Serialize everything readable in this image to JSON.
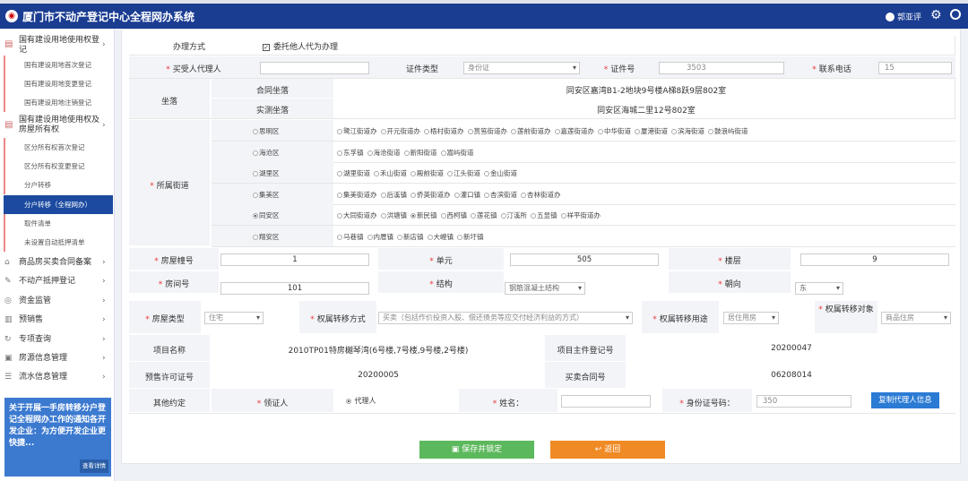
{
  "header": {
    "title": "厦门市不动产登记中心全程网办系统",
    "user": "郭亚评"
  },
  "sidebar": {
    "group1": "国有建设用地使用权登记",
    "group1_items": [
      "国有建设用地首次登记",
      "国有建设用地变更登记",
      "国有建设用地注销登记"
    ],
    "group2": "国有建设用地使用权及房屋所有权",
    "group2_items": [
      "区分所有权首次登记",
      "区分所有权变更登记",
      "分户转移",
      "分户转移（全程网办）",
      "取件清单",
      "未设置自动抵押清单"
    ],
    "menu": [
      "商品房买卖合同备案",
      "不动产抵押登记",
      "资金监管",
      "预销售",
      "专项查询",
      "房源信息管理",
      "流水信息管理"
    ],
    "notice": "关于开展一手房转移分户登记全程网办工作的通知各开发企业：为方便开发企业更快捷...",
    "notice_more": "查看详情"
  },
  "form": {
    "method_label": "办理方式",
    "method_value": "委托他人代为办理",
    "agent_label": "买受人代理人",
    "idtype_label": "证件类型",
    "idtype_value": "身份证",
    "idno_label": "证件号",
    "idno_value": "3503",
    "phone_label": "联系电话",
    "phone_value": "15",
    "loc_label": "坐落",
    "contract_loc_label": "合同坐落",
    "contract_loc_value": "同安区嘉湾B1-2地块9号楼A梯8跃9层802室",
    "actual_loc_label": "实测坐落",
    "actual_loc_value": "同安区海城二里12号802室",
    "street_label": "所属街道",
    "districts": [
      {
        "name": "思明区",
        "streets": [
          "鹭江街道办",
          "开元街道办",
          "梧村街道办",
          "筼筜街道办",
          "莲前街道办",
          "嘉莲街道办",
          "中华街道",
          "厦港街道",
          "滨海街道",
          "鼓浪屿街道"
        ]
      },
      {
        "name": "海沧区",
        "streets": [
          "东孚镇",
          "海沧街道",
          "新阳街道",
          "嵩屿街道"
        ]
      },
      {
        "name": "湖里区",
        "streets": [
          "湖里街道",
          "禾山街道",
          "殿前街道",
          "江头街道",
          "金山街道"
        ]
      },
      {
        "name": "集美区",
        "streets": [
          "集美街道办",
          "后溪镇",
          "侨英街道办",
          "灌口镇",
          "杏滨街道",
          "杏林街道办"
        ]
      },
      {
        "name": "同安区",
        "streets": [
          "大同街道办",
          "洪塘镇",
          "新民镇",
          "西柯镇",
          "莲花镇",
          "汀溪所",
          "五显镇",
          "祥平街道办"
        ]
      },
      {
        "name": "翔安区",
        "streets": [
          "马巷镇",
          "内厝镇",
          "新店镇",
          "大嶝镇",
          "新圩镇"
        ]
      }
    ],
    "building_label": "房屋幢号",
    "building_value": "1",
    "unit_label": "单元",
    "unit_value": "505",
    "floor_label": "楼层",
    "floor_value": "9",
    "room_label": "房间号",
    "room_value": "101",
    "struct_label": "结构",
    "struct_value": "钢筋混凝土结构",
    "orient_label": "朝向",
    "orient_value": "东",
    "htype_label": "房屋类型",
    "htype_value": "住宅",
    "tmethod_label": "权属转移方式",
    "tmethod_value": "买卖（包括作价投资入股、偿还债务等应交付经济利益的方式）",
    "tuse_label": "权属转移用途",
    "tuse_value": "居住用房",
    "tobj_label": "权属转移对象",
    "tobj_value": "商品住房",
    "proj_label": "项目名称",
    "proj_value": "2010TP01特房樾琴湾(6号楼,7号楼,9号楼,2号楼)",
    "projno_label": "项目主件登记号",
    "projno_value": "20200047",
    "presale_label": "预售许可证号",
    "presale_value": "20200005",
    "contract_label": "买卖合同号",
    "contract_value": "06208014",
    "other_label": "其他约定",
    "recv_label": "领证人",
    "recv_value": "代理人",
    "name_label": "姓名：",
    "idcode_label": "身份证号码：",
    "idcode_value": "350",
    "copy_btn": "复制代理人信息",
    "save_btn": "保存并锁定",
    "back_btn": "返回"
  }
}
